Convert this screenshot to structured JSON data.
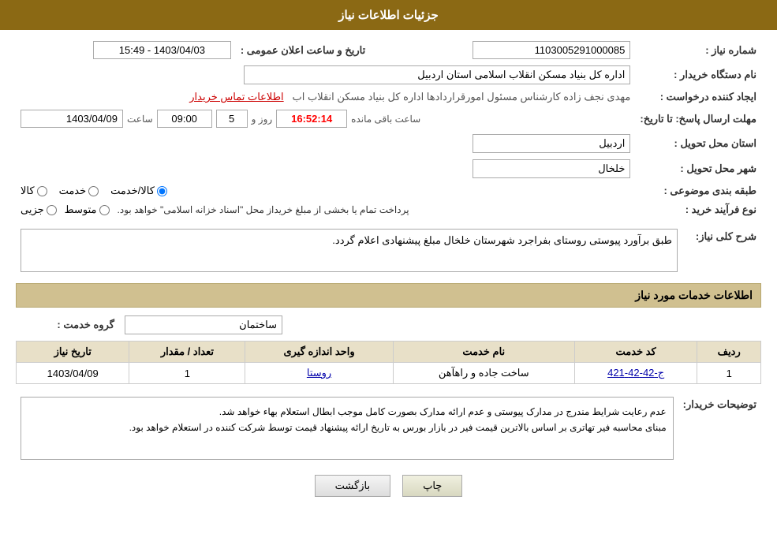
{
  "header": {
    "title": "جزئیات اطلاعات نیاز"
  },
  "fields": {
    "need_number_label": "شماره نیاز :",
    "need_number_value": "1103005291000085",
    "buyer_org_label": "نام دستگاه خریدار :",
    "buyer_org_value": "اداره کل بنیاد مسکن انقلاب اسلامی استان اردبیل",
    "creator_label": "ایجاد کننده درخواست :",
    "creator_value": "مهدی نجف زاده کارشناس مسئول امورقراردادها اداره کل بنیاد مسکن انقلاب اب",
    "creator_link": "اطلاعات تماس خریدار",
    "deadline_label": "مهلت ارسال پاسخ: تا تاریخ:",
    "deadline_date": "1403/04/09",
    "deadline_time": "09:00",
    "deadline_days": "5",
    "deadline_remaining": "16:52:14",
    "deadline_time_label": "ساعت",
    "deadline_days_label": "روز و",
    "deadline_remaining_label": "ساعت باقی مانده",
    "province_label": "استان محل تحویل :",
    "province_value": "اردبیل",
    "city_label": "شهر محل تحویل :",
    "city_value": "خلخال",
    "category_label": "طبقه بندی موضوعی :",
    "category_goods": "کالا",
    "category_service": "خدمت",
    "category_goods_service": "کالا/خدمت",
    "purchase_type_label": "نوع فرآیند خرید :",
    "purchase_type_partial": "جزیی",
    "purchase_type_medium": "متوسط",
    "purchase_type_desc": "پرداخت تمام یا بخشی از مبلغ خریداز محل \"اسناد خزانه اسلامی\" خواهد بود.",
    "announcement_label": "تاریخ و ساعت اعلان عمومی :",
    "announcement_value": "1403/04/03 - 15:49",
    "need_description_label": "شرح کلی نیاز:",
    "need_description_value": "طبق برآورد پیوستی روستای بفراجرد شهرستان خلخال مبلغ پیشنهادی اعلام گردد.",
    "services_section_label": "اطلاعات خدمات مورد نیاز",
    "service_group_label": "گروه خدمت :",
    "service_group_value": "ساختمان",
    "table_headers": {
      "row_num": "ردیف",
      "service_code": "کد خدمت",
      "service_name": "نام خدمت",
      "unit": "واحد اندازه گیری",
      "quantity": "تعداد / مقدار",
      "need_date": "تاریخ نیاز"
    },
    "table_rows": [
      {
        "row_num": "1",
        "service_code": "ج-42-42-421",
        "service_name": "ساخت جاده و راهآهن",
        "unit": "روستا",
        "quantity": "1",
        "need_date": "1403/04/09"
      }
    ],
    "buyer_notes_label": "توضیحات خریدار:",
    "buyer_notes_value": "عدم رعایت شرایط مندرج در مدارک پیوستی و عدم ارائه مدارک بصورت کامل موجب ابطال استعلام بهاء خواهد شد.\nمبنای محاسبه فیر تهاتری بر اساس بالاترین قیمت فیر در بازار بورس به تاریخ ارائه پیشنهاد قیمت توسط شرکت کننده در استعلام خواهد بود.",
    "btn_back": "بازگشت",
    "btn_print": "چاپ"
  }
}
